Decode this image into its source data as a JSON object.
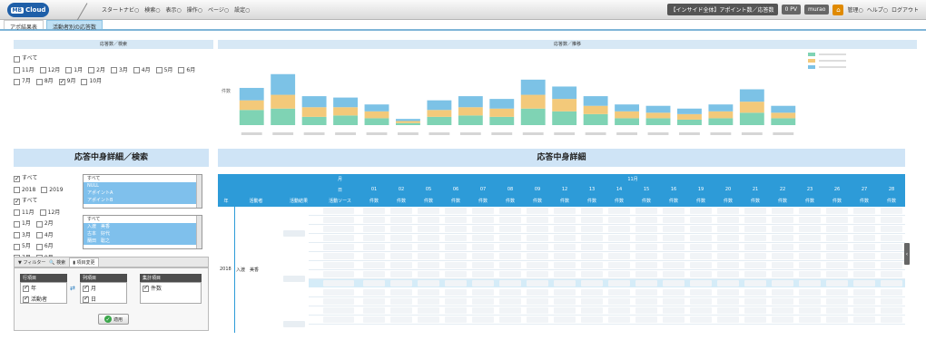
{
  "header": {
    "logo_prefix": "MB",
    "logo_text": "Cloud",
    "menu": [
      "スタートナビ○",
      "検索○",
      "表示○",
      "操作○",
      "ページ○",
      "設定○"
    ],
    "context": "【インサイド全体】アポイント数／応答数",
    "pill_pv": "0 PV",
    "user": "murao",
    "right_menu": [
      "管理○",
      "ヘルプ○",
      "ログアウト"
    ]
  },
  "tabs": [
    {
      "label": "アポ結果表"
    },
    {
      "label": "活動者別の応答数"
    }
  ],
  "top_left_panel": {
    "title": "応答数／検索",
    "all_label": "すべて",
    "months": [
      "11月",
      "12月",
      "1月",
      "2月",
      "3月",
      "4月",
      "5月",
      "6月",
      "7月",
      "8月",
      "9月",
      "10月"
    ],
    "checked_months": [
      "9月"
    ]
  },
  "chart_panel": {
    "title": "応答数／推移",
    "ylabel": "件数"
  },
  "chart_data": {
    "type": "bar",
    "stacked": true,
    "ylim": [
      0,
      100
    ],
    "grid": false,
    "legend": "top-right",
    "colors": [
      "#7fd3b4",
      "#f3c97a",
      "#7cc2e6"
    ],
    "values": [
      [
        22,
        14,
        18
      ],
      [
        24,
        20,
        30
      ],
      [
        12,
        14,
        16
      ],
      [
        14,
        12,
        14
      ],
      [
        10,
        10,
        10
      ],
      [
        3,
        3,
        3
      ],
      [
        12,
        10,
        14
      ],
      [
        14,
        12,
        16
      ],
      [
        12,
        12,
        14
      ],
      [
        24,
        20,
        22
      ],
      [
        20,
        18,
        18
      ],
      [
        16,
        12,
        14
      ],
      [
        10,
        10,
        10
      ],
      [
        10,
        8,
        10
      ],
      [
        8,
        8,
        8
      ],
      [
        10,
        10,
        10
      ],
      [
        18,
        16,
        18
      ],
      [
        10,
        8,
        10
      ]
    ]
  },
  "big_titles": {
    "left": "応答中身詳細／検索",
    "right": "応答中身詳細"
  },
  "year_list": {
    "items": [
      {
        "label": "すべて",
        "checked": true
      },
      {
        "label": "2018",
        "checked": false
      },
      {
        "label": "2019",
        "checked": false
      },
      {
        "label": "すべて",
        "checked": true
      },
      {
        "label": "11月",
        "checked": false
      },
      {
        "label": "12月",
        "checked": false
      },
      {
        "label": "1月",
        "checked": false
      },
      {
        "label": "2月",
        "checked": false
      },
      {
        "label": "3月",
        "checked": false
      },
      {
        "label": "4月",
        "checked": false
      },
      {
        "label": "5月",
        "checked": false
      },
      {
        "label": "6月",
        "checked": false
      },
      {
        "label": "7月",
        "checked": false
      },
      {
        "label": "8月",
        "checked": false
      }
    ]
  },
  "listbox1": [
    "すべて",
    "NULL",
    "アポイントA",
    "アポイントB"
  ],
  "listbox2": [
    "すべて",
    "入渡　美香",
    "古本　好代",
    "蘭田　聡之"
  ],
  "controls": {
    "tabs": [
      "フィルター",
      "検索",
      "項目変更"
    ],
    "row_title": "行項目",
    "col_title": "列項目",
    "sum_title": "集計項目",
    "row_items": [
      "年",
      "活動者"
    ],
    "col_items": [
      "月",
      "日"
    ],
    "sum_items": [
      "件数"
    ],
    "apply_label": "適用"
  },
  "detail": {
    "month_label": "月",
    "day_label": "日",
    "month_value": "11月",
    "col_headers": [
      "年",
      "活動者",
      "活動結果",
      "活動ソース"
    ],
    "days": [
      "01",
      "02",
      "05",
      "06",
      "07",
      "08",
      "09",
      "12",
      "13",
      "14",
      "15",
      "16",
      "19",
      "20",
      "21",
      "22",
      "23",
      "26",
      "27",
      "28"
    ],
    "unit": "件数",
    "year": "2018",
    "person": "入渡　美香"
  }
}
